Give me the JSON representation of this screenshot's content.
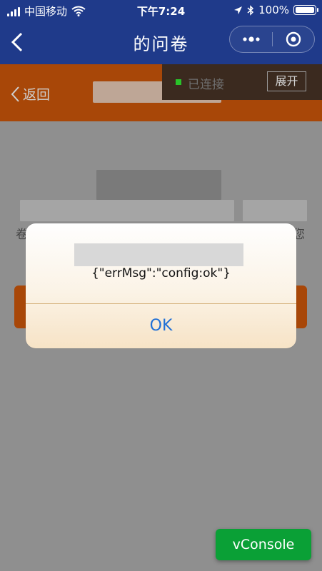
{
  "status_bar": {
    "carrier": "中国移动",
    "time": "下午7:24",
    "battery": "100%",
    "icons": [
      "signal-icon",
      "wifi-icon",
      "location-arrow-icon",
      "bluetooth-icon",
      "battery-icon"
    ]
  },
  "nav": {
    "title": "的问卷",
    "back_icon": "chevron-left-icon",
    "more_icon": "ellipsis-icon",
    "close_icon": "target-close-icon"
  },
  "page": {
    "back_label": "返回",
    "side_char_left": "卷",
    "side_char_right": "您"
  },
  "vconsole_bar": {
    "status": "已连接",
    "expand": "展开"
  },
  "dialog": {
    "message": "{\"errMsg\":\"config:ok\"}",
    "ok": "OK"
  },
  "vconsole": {
    "label": "vConsole"
  },
  "colors": {
    "nav_blue": "#1f3a8a",
    "page_orange": "#a84708",
    "link_blue": "#1f6fd6",
    "vconsole_green": "#0aa036"
  }
}
